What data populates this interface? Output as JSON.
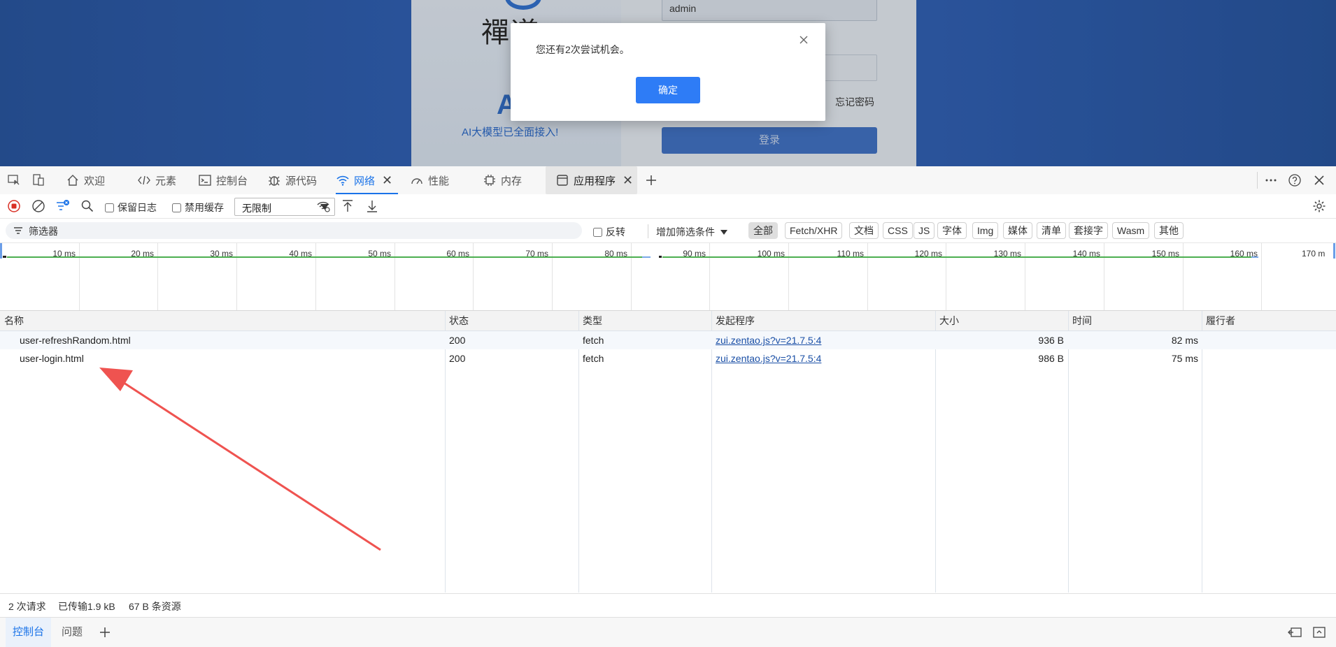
{
  "web_page": {
    "logo_text": "禪道",
    "username_value": "admin",
    "ai_big": "AI",
    "ai_slogan": "AI大模型已全面接入!",
    "forgot_password": "忘记密码",
    "login_button": "登录"
  },
  "dialog": {
    "message": "您还有2次尝试机会。",
    "ok_label": "确定",
    "close_icon": "close-icon"
  },
  "devtools": {
    "tabs": [
      {
        "label": "欢迎",
        "icon": "home-icon"
      },
      {
        "label": "元素",
        "icon": "code-icon"
      },
      {
        "label": "控制台",
        "icon": "console-icon"
      },
      {
        "label": "源代码",
        "icon": "bug-icon"
      },
      {
        "label": "网络",
        "icon": "wifi-icon",
        "active": true
      },
      {
        "label": "性能",
        "icon": "gauge-icon"
      },
      {
        "label": "内存",
        "icon": "chip-icon"
      },
      {
        "label": "应用程序",
        "icon": "window-icon"
      }
    ],
    "toolbar": {
      "preserve_log": "保留日志",
      "disable_cache": "禁用缓存",
      "throttle": "无限制"
    },
    "filter": {
      "placeholder": "筛选器",
      "invert": "反转",
      "more_filters": "增加筛选条件",
      "types": [
        "全部",
        "Fetch/XHR",
        "文档",
        "CSS",
        "JS",
        "字体",
        "Img",
        "媒体",
        "清单",
        "套接字",
        "Wasm",
        "其他"
      ]
    },
    "timeline_ticks": [
      "10 ms",
      "20 ms",
      "30 ms",
      "40 ms",
      "50 ms",
      "60 ms",
      "70 ms",
      "80 ms",
      "90 ms",
      "100 ms",
      "110 ms",
      "120 ms",
      "130 ms",
      "140 ms",
      "150 ms",
      "160 ms",
      "170 m"
    ],
    "table": {
      "headers": [
        "名称",
        "状态",
        "类型",
        "发起程序",
        "大小",
        "时间",
        "履行者"
      ],
      "rows": [
        {
          "name": "user-refreshRandom.html",
          "status": "200",
          "type": "fetch",
          "initiator": "zui.zentao.js?v=21.7.5:4",
          "size": "936 B",
          "time": "82 ms"
        },
        {
          "name": "user-login.html",
          "status": "200",
          "type": "fetch",
          "initiator": "zui.zentao.js?v=21.7.5:4",
          "size": "986 B",
          "time": "75 ms"
        }
      ]
    },
    "summary": {
      "requests": "2 次请求",
      "transferred": "已传输1.9 kB",
      "resources": "67 B 条资源"
    },
    "drawer": {
      "tabs": [
        "控制台",
        "问题"
      ]
    }
  },
  "colors": {
    "accent": "#1a73e8",
    "dialog_ok": "#2e7cf6",
    "page_bg": "#2253a8",
    "arrow": "#ef5350"
  }
}
